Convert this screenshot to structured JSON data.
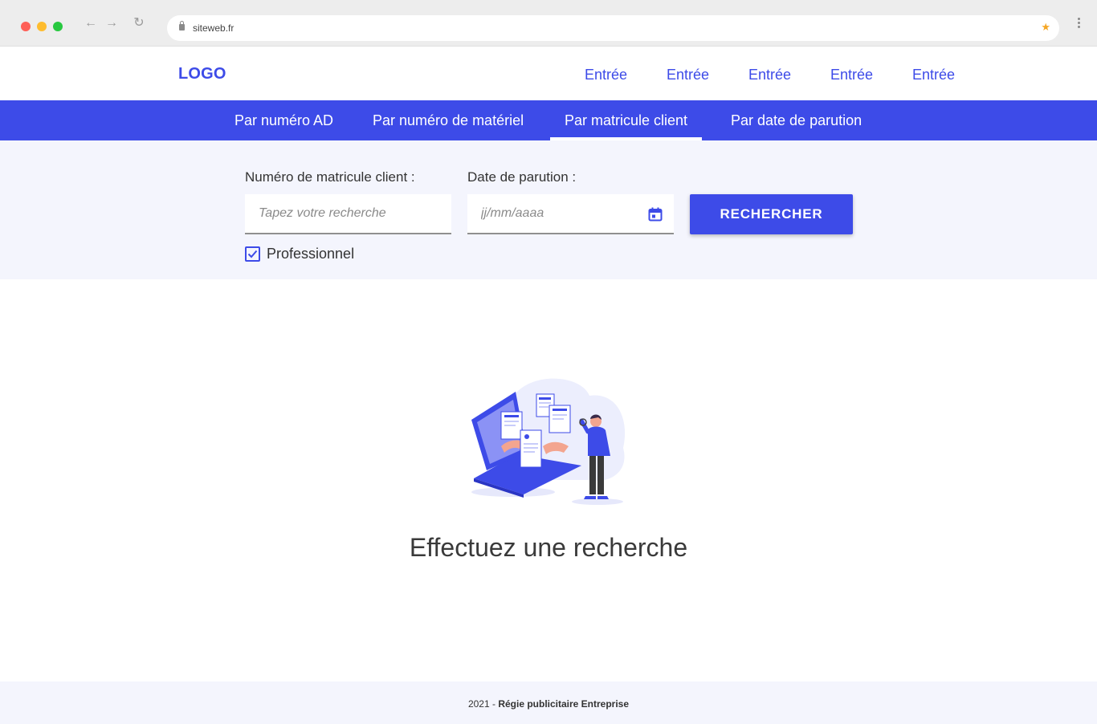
{
  "browser": {
    "url": "siteweb.fr"
  },
  "header": {
    "logo": "LOGO",
    "nav": [
      "Entrée",
      "Entrée",
      "Entrée",
      "Entrée",
      "Entrée"
    ]
  },
  "tabs": {
    "items": [
      "Par numéro AD",
      "Par numéro de matériel",
      "Par matricule client",
      "Par date de parution"
    ],
    "active_index": 2
  },
  "search": {
    "matricule_label": "Numéro de matricule client :",
    "matricule_placeholder": "Tapez votre recherche",
    "date_label": "Date de parution :",
    "date_placeholder": "jj/mm/aaaa",
    "button_label": "RECHERCHER",
    "checkbox_label": "Professionnel",
    "checkbox_checked": true
  },
  "empty_state": {
    "message": "Effectuez une recherche"
  },
  "footer": {
    "year": "2021 - ",
    "company": "Régie publicitaire Entreprise"
  },
  "colors": {
    "accent": "#3d4be8",
    "panel_bg": "#f4f5fd"
  }
}
